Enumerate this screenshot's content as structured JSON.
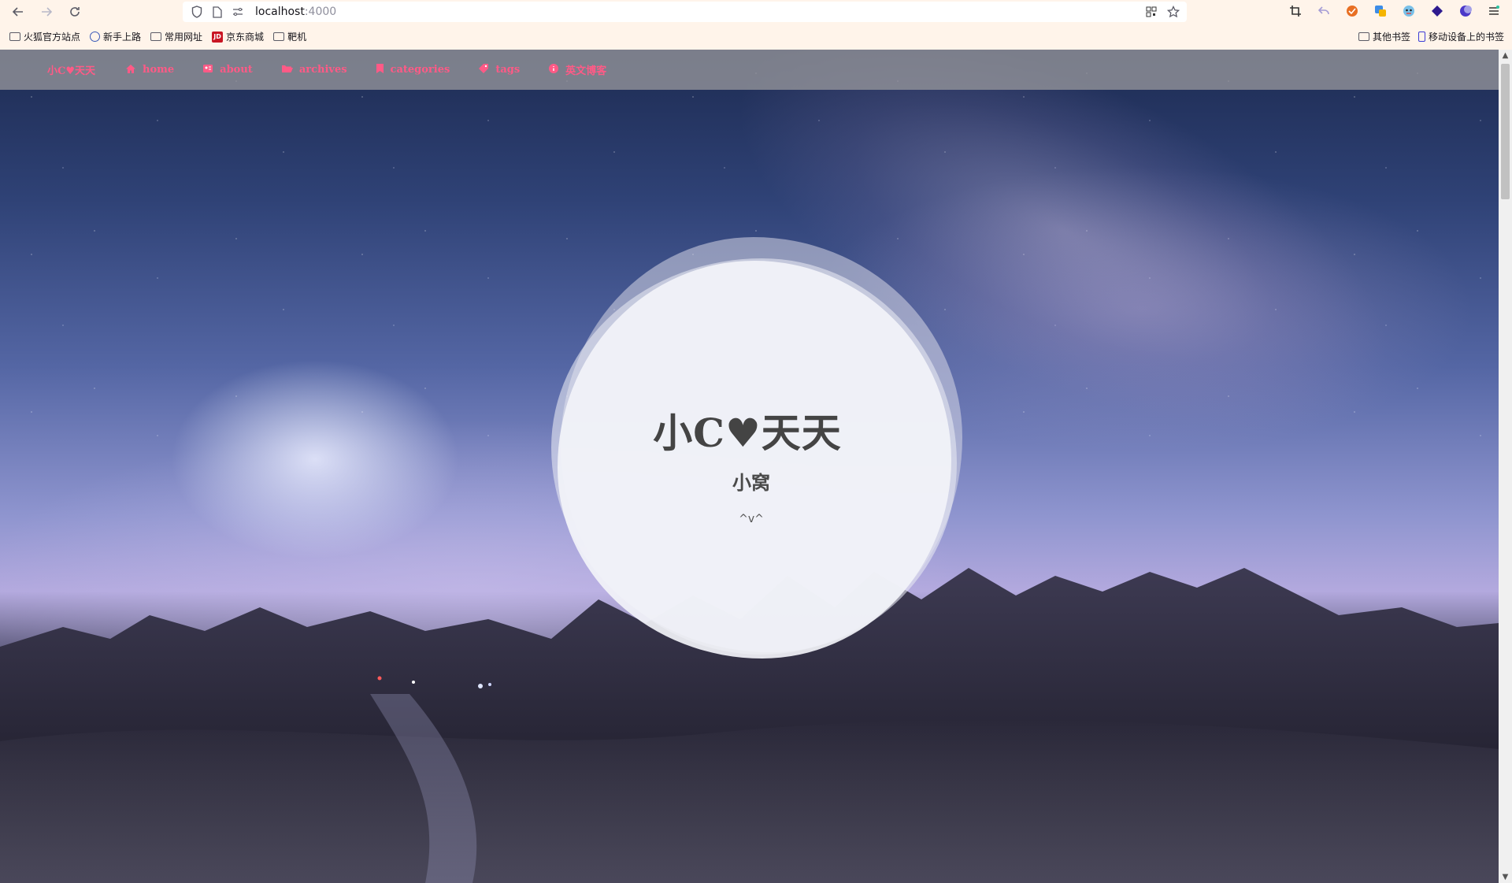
{
  "browser": {
    "url_host": "localhost",
    "url_port": ":4000"
  },
  "bookmarks": {
    "items": [
      {
        "label": "火狐官方站点",
        "icon": "folder-icon"
      },
      {
        "label": "新手上路",
        "icon": "globe-icon"
      },
      {
        "label": "常用网址",
        "icon": "folder-icon"
      },
      {
        "label": "京东商城",
        "icon": "jd-icon"
      },
      {
        "label": "靶机",
        "icon": "folder-icon"
      }
    ],
    "right": [
      {
        "label": "其他书签",
        "icon": "folder-icon"
      },
      {
        "label": "移动设备上的书签",
        "icon": "mobile-icon"
      }
    ]
  },
  "site_nav": {
    "brand": "小C♥天天",
    "items": [
      {
        "label": "home",
        "icon": "home-icon"
      },
      {
        "label": "about",
        "icon": "id-card-icon"
      },
      {
        "label": "archives",
        "icon": "folder-open-icon"
      },
      {
        "label": "categories",
        "icon": "bookmark-icon"
      },
      {
        "label": "tags",
        "icon": "tag-icon"
      },
      {
        "label": "英文博客",
        "icon": "circle-info-icon"
      }
    ]
  },
  "hero": {
    "title": "小C♥天天",
    "subtitle": "小窝",
    "face": "^v^"
  },
  "colors": {
    "nav_accent": "#ff5a86",
    "toolbar_bg": "#fff4ea"
  }
}
